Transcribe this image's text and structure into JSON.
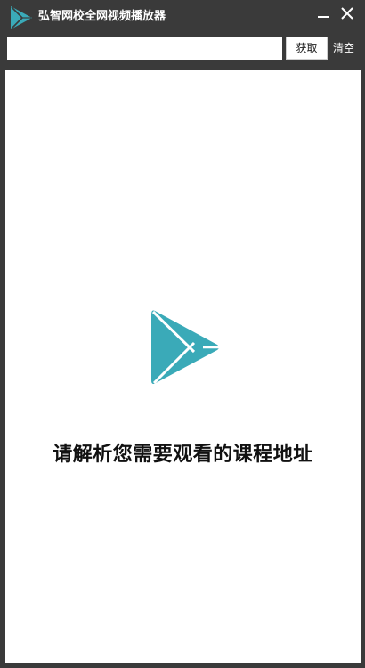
{
  "window": {
    "title": "弘智网校全网视频播放器",
    "minimize_icon": "minimize-icon",
    "close_icon": "close-icon"
  },
  "toolbar": {
    "url_input_value": "",
    "url_input_placeholder": "",
    "fetch_label": "获取",
    "clear_label": "清空"
  },
  "main": {
    "placeholder_icon": "play-logo-icon",
    "prompt": "请解析您需要观看的课程地址"
  },
  "colors": {
    "window_background": "#3a3a3a",
    "content_background": "#ffffff",
    "logo_teal": "#3aaab8"
  }
}
